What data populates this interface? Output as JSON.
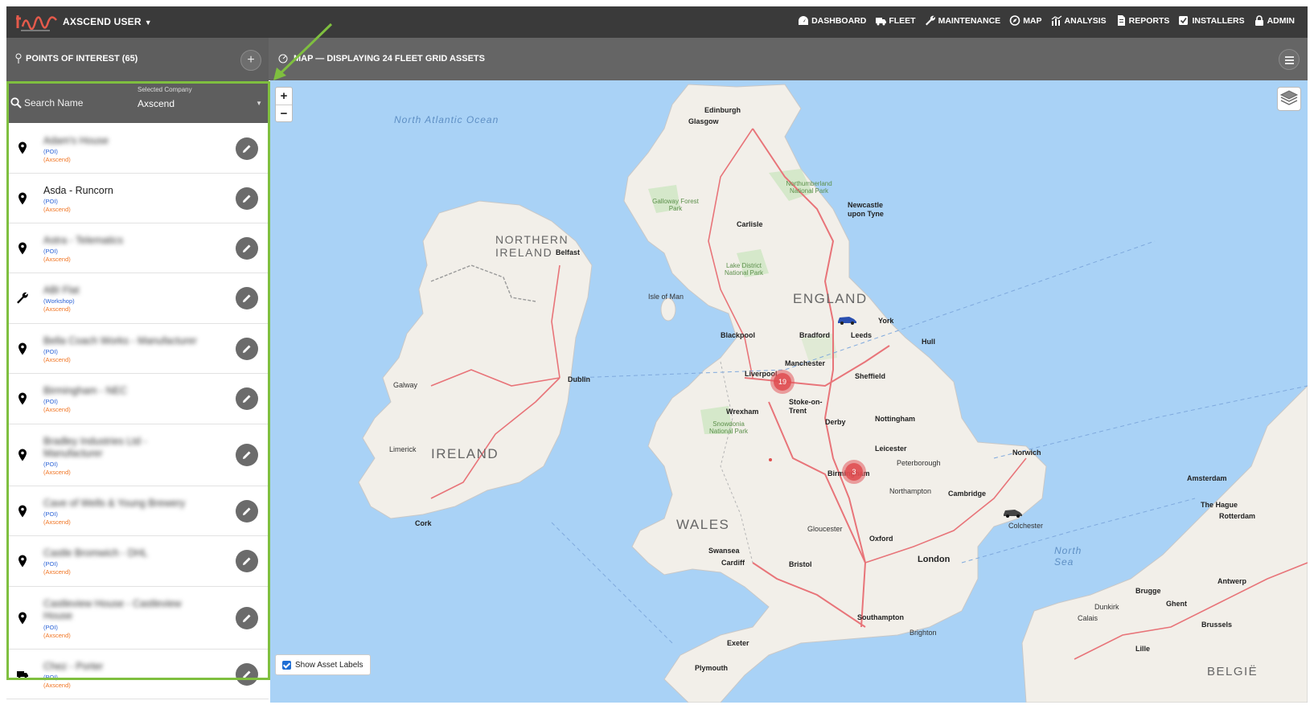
{
  "header": {
    "user_menu": "AXSCEND USER",
    "nav": [
      {
        "label": "DASHBOARD",
        "icon": "dashboard-icon"
      },
      {
        "label": "FLEET",
        "icon": "truck-icon"
      },
      {
        "label": "MAINTENANCE",
        "icon": "wrench-icon"
      },
      {
        "label": "MAP",
        "icon": "compass-icon"
      },
      {
        "label": "ANALYSIS",
        "icon": "chart-icon"
      },
      {
        "label": "REPORTS",
        "icon": "document-icon"
      },
      {
        "label": "INSTALLERS",
        "icon": "checkbox-icon"
      },
      {
        "label": "ADMIN",
        "icon": "lock-icon"
      }
    ]
  },
  "poi_panel": {
    "title": "POINTS OF INTEREST (65)",
    "add_label": "+",
    "search_placeholder": "Search Name",
    "company_label": "Selected Company",
    "company_value": "Axscend",
    "items": [
      {
        "name": "Adam's House",
        "type": "(POI)",
        "company": "(Axscend)",
        "icon": "map-pin-icon",
        "blurred": true
      },
      {
        "name": "Asda - Runcorn",
        "type": "(POI)",
        "company": "(Axscend)",
        "icon": "map-pin-icon",
        "blurred": false
      },
      {
        "name": "Astra - Telematics",
        "type": "(POI)",
        "company": "(Axscend)",
        "icon": "map-pin-icon",
        "blurred": true
      },
      {
        "name": "ABI Flat",
        "type": "(Workshop)",
        "company": "(Axscend)",
        "icon": "wrench-icon",
        "blurred": true
      },
      {
        "name": "Bella Coach Works - Manufacturer",
        "type": "(POI)",
        "company": "(Axscend)",
        "icon": "map-pin-icon",
        "blurred": true
      },
      {
        "name": "Birmingham - NEC",
        "type": "(POI)",
        "company": "(Axscend)",
        "icon": "map-pin-icon",
        "blurred": true
      },
      {
        "name": "Bradley Industries Ltd - Manufacturer",
        "type": "(POI)",
        "company": "(Axscend)",
        "icon": "map-pin-icon",
        "blurred": true
      },
      {
        "name": "Cave of Wells & Young Brewery",
        "type": "(POI)",
        "company": "(Axscend)",
        "icon": "map-pin-icon",
        "blurred": true
      },
      {
        "name": "Castle Bromwich - DHL",
        "type": "(POI)",
        "company": "(Axscend)",
        "icon": "map-pin-icon",
        "blurred": true
      },
      {
        "name": "Castleview House - Castleview House",
        "type": "(POI)",
        "company": "(Axscend)",
        "icon": "map-pin-icon",
        "blurred": true
      },
      {
        "name": "Chez - Porter",
        "type": "(POI)",
        "company": "(Axscend)",
        "icon": "truck-icon",
        "blurred": true
      }
    ]
  },
  "map": {
    "title": "MAP — DISPLAYING 24 FLEET GRID ASSETS",
    "zoom_in": "+",
    "zoom_out": "−",
    "show_asset_labels": "Show Asset Labels",
    "show_asset_labels_checked": true,
    "clusters": [
      "19",
      "3"
    ],
    "labels": {
      "north_atlantic": "North Atlantic Ocean",
      "north_sea": "North Sea",
      "england": "ENGLAND",
      "wales": "WALES",
      "ireland": "IRELAND",
      "northern_ireland": "NORTHERN IRELAND",
      "edinburgh": "Edinburgh",
      "glasgow": "Glasgow",
      "dublin": "Dublin",
      "belfast": "Belfast",
      "liverpool": "Liverpool",
      "manchester": "Manchester",
      "leeds": "Leeds",
      "york": "York",
      "newcastle": "Newcastle upon Tyne",
      "carlisle": "Carlisle",
      "sheffield": "Sheffield",
      "nottingham": "Nottingham",
      "leicester": "Leicester",
      "birmingham": "Birmingham",
      "norwich": "Norwich",
      "cambridge": "Cambridge",
      "oxford": "Oxford",
      "london": "London",
      "bristol": "Bristol",
      "cardiff": "Cardiff",
      "swansea": "Swansea",
      "cork": "Cork",
      "limerick": "Limerick",
      "galway": "Galway",
      "plymouth": "Plymouth",
      "exeter": "Exeter",
      "southampton": "Southampton",
      "brighton": "Brighton",
      "hull": "Hull",
      "colchester": "Colchester",
      "derby": "Derby",
      "stoke": "Stoke-on-Trent",
      "wrexham": "Wrexham",
      "blackpool": "Blackpool",
      "bradford": "Bradford",
      "peterborough": "Peterborough",
      "northampton": "Northampton",
      "gloucester": "Gloucester",
      "rotterdam": "Rotterdam",
      "amsterdam": "Amsterdam",
      "the_hague": "The Hague",
      "brugge": "Brugge",
      "ghent": "Ghent",
      "antwerp": "Antwerp",
      "brussels": "Brussels",
      "lille": "Lille",
      "dunkirk": "Dunkirk",
      "calais": "Calais",
      "belgium": "BELGIË",
      "isle_of_man": "Isle of Man",
      "northumberland": "Northumberland National Park",
      "lake_district": "Lake District National Park",
      "snowdonia": "Snowdonia National Park",
      "galloway": "Galloway Forest Park"
    }
  }
}
